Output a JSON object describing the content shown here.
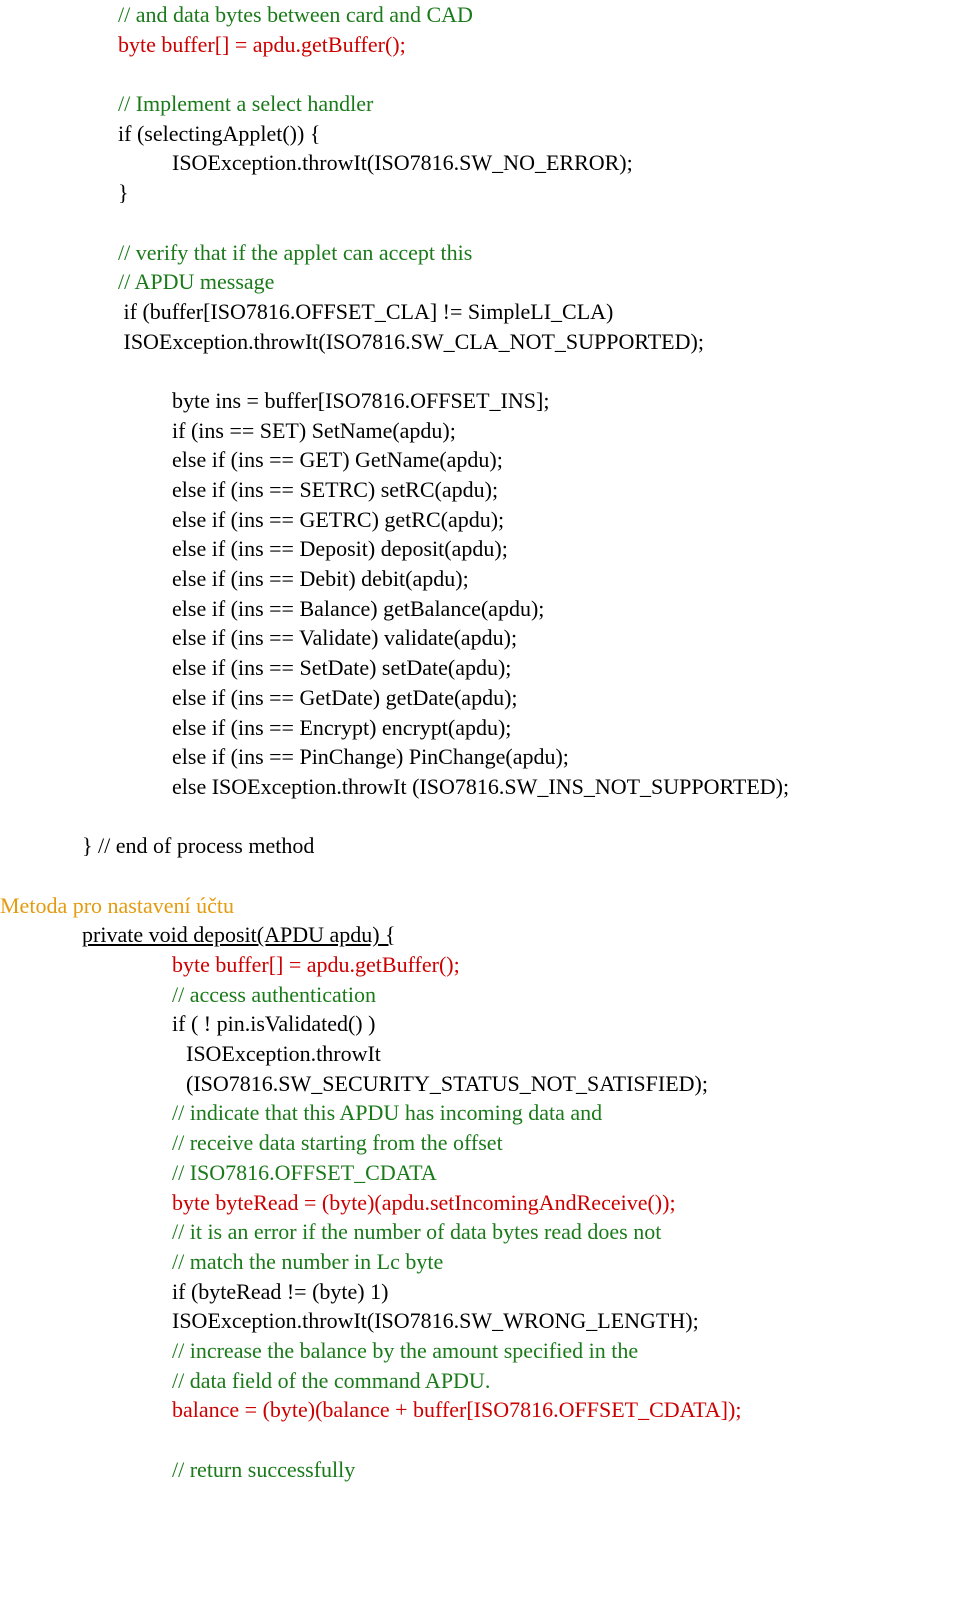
{
  "lines": [
    {
      "indent": "ind1",
      "spans": [
        {
          "cls": "c-green",
          "text": "// and data bytes between card and CAD"
        }
      ]
    },
    {
      "indent": "ind1",
      "spans": [
        {
          "cls": "c-red",
          "text": "byte buffer[] = apdu.getBuffer();"
        }
      ]
    },
    {
      "indent": "ind1",
      "spans": [
        {
          "cls": "c-black",
          "text": " "
        }
      ]
    },
    {
      "indent": "ind1",
      "spans": [
        {
          "cls": "c-green",
          "text": "// Implement a select handler"
        }
      ]
    },
    {
      "indent": "ind1",
      "spans": [
        {
          "cls": "c-black",
          "text": "if (selectingApplet()) {"
        }
      ]
    },
    {
      "indent": "ind2",
      "spans": [
        {
          "cls": "c-black",
          "text": "ISOException.throwIt(ISO7816.SW_NO_ERROR);"
        }
      ]
    },
    {
      "indent": "ind1",
      "spans": [
        {
          "cls": "c-black",
          "text": "}"
        }
      ]
    },
    {
      "indent": "ind1",
      "spans": [
        {
          "cls": "c-black",
          "text": " "
        }
      ]
    },
    {
      "indent": "ind1",
      "spans": [
        {
          "cls": "c-green",
          "text": "// verify that if the applet can accept this"
        }
      ]
    },
    {
      "indent": "ind1",
      "spans": [
        {
          "cls": "c-green",
          "text": "// APDU message"
        }
      ]
    },
    {
      "indent": "ind1",
      "spans": [
        {
          "cls": "c-black",
          "text": " if (buffer[ISO7816.OFFSET_CLA] != SimpleLI_CLA)"
        }
      ]
    },
    {
      "indent": "ind1",
      "spans": [
        {
          "cls": "c-black",
          "text": " ISOException.throwIt(ISO7816.SW_CLA_NOT_SUPPORTED);"
        }
      ]
    },
    {
      "indent": "ind1",
      "spans": [
        {
          "cls": "c-black",
          "text": " "
        }
      ]
    },
    {
      "indent": "ind2",
      "spans": [
        {
          "cls": "c-black",
          "text": "byte ins = buffer[ISO7816.OFFSET_INS];"
        }
      ]
    },
    {
      "indent": "ind2",
      "spans": [
        {
          "cls": "c-black",
          "text": "if (ins == SET) SetName(apdu);"
        }
      ]
    },
    {
      "indent": "ind2",
      "spans": [
        {
          "cls": "c-black",
          "text": "else if (ins == GET) GetName(apdu);"
        }
      ]
    },
    {
      "indent": "ind2",
      "spans": [
        {
          "cls": "c-black",
          "text": "else if (ins == SETRC) setRC(apdu);"
        }
      ]
    },
    {
      "indent": "ind2",
      "spans": [
        {
          "cls": "c-black",
          "text": "else if (ins == GETRC) getRC(apdu);"
        }
      ]
    },
    {
      "indent": "ind2",
      "spans": [
        {
          "cls": "c-black",
          "text": "else if (ins == Deposit) deposit(apdu);"
        }
      ]
    },
    {
      "indent": "ind2",
      "spans": [
        {
          "cls": "c-black",
          "text": "else if (ins == Debit) debit(apdu);"
        }
      ]
    },
    {
      "indent": "ind2",
      "spans": [
        {
          "cls": "c-black",
          "text": "else if (ins == Balance) getBalance(apdu);"
        }
      ]
    },
    {
      "indent": "ind2",
      "spans": [
        {
          "cls": "c-black",
          "text": "else if (ins == Validate) validate(apdu);"
        }
      ]
    },
    {
      "indent": "ind2",
      "spans": [
        {
          "cls": "c-black",
          "text": "else if (ins == SetDate) setDate(apdu);"
        }
      ]
    },
    {
      "indent": "ind2",
      "spans": [
        {
          "cls": "c-black",
          "text": "else if (ins == GetDate) getDate(apdu);"
        }
      ]
    },
    {
      "indent": "ind2",
      "spans": [
        {
          "cls": "c-black",
          "text": "else if (ins == Encrypt) encrypt(apdu);"
        }
      ]
    },
    {
      "indent": "ind2",
      "spans": [
        {
          "cls": "c-black",
          "text": "else if (ins == PinChange) PinChange(apdu);"
        }
      ]
    },
    {
      "indent": "ind2",
      "spans": [
        {
          "cls": "c-black",
          "text": "else ISOException.throwIt (ISO7816.SW_INS_NOT_SUPPORTED);"
        }
      ]
    },
    {
      "indent": "ind1",
      "spans": [
        {
          "cls": "c-black",
          "text": " "
        }
      ]
    },
    {
      "indent": "ind05",
      "spans": [
        {
          "cls": "c-black",
          "text": "} // end of process method"
        }
      ]
    },
    {
      "indent": "ind0",
      "spans": [
        {
          "cls": "c-black",
          "text": " "
        }
      ]
    },
    {
      "indent": "ind0",
      "spans": [
        {
          "cls": "c-orange",
          "text": "Metoda pro nastavení účtu"
        }
      ]
    },
    {
      "indent": "ind05",
      "spans": [
        {
          "cls": "c-black u",
          "text": "private void deposit(APDU apdu) {"
        }
      ]
    },
    {
      "indent": "ind2",
      "spans": [
        {
          "cls": "c-red",
          "text": "byte buffer[] = apdu.getBuffer();"
        }
      ]
    },
    {
      "indent": "ind2",
      "spans": [
        {
          "cls": "c-green",
          "text": "// access authentication"
        }
      ]
    },
    {
      "indent": "ind2",
      "spans": [
        {
          "cls": "c-black",
          "text": "if ( ! pin.isValidated() )"
        }
      ]
    },
    {
      "indent": "ind3",
      "spans": [
        {
          "cls": "c-black",
          "text": "ISOException.throwIt"
        }
      ]
    },
    {
      "indent": "ind3",
      "spans": [
        {
          "cls": "c-black",
          "text": "(ISO7816.SW_SECURITY_STATUS_NOT_SATISFIED);"
        }
      ]
    },
    {
      "indent": "ind2",
      "spans": [
        {
          "cls": "c-green",
          "text": "// indicate that this APDU has incoming data and"
        }
      ]
    },
    {
      "indent": "ind2",
      "spans": [
        {
          "cls": "c-green",
          "text": "// receive data starting from the offset"
        }
      ]
    },
    {
      "indent": "ind2",
      "spans": [
        {
          "cls": "c-green",
          "text": "// ISO7816.OFFSET_CDATA"
        }
      ]
    },
    {
      "indent": "ind2",
      "spans": [
        {
          "cls": "c-red",
          "text": "byte byteRead = (byte)(apdu.setIncomingAndReceive());"
        }
      ]
    },
    {
      "indent": "ind2",
      "spans": [
        {
          "cls": "c-green",
          "text": "// it is an error if the number of data bytes read does not"
        }
      ]
    },
    {
      "indent": "ind2",
      "spans": [
        {
          "cls": "c-green",
          "text": "// match the number in Lc byte"
        }
      ]
    },
    {
      "indent": "ind2",
      "spans": [
        {
          "cls": "c-black",
          "text": "if (byteRead != (byte) 1)"
        }
      ]
    },
    {
      "indent": "ind2",
      "spans": [
        {
          "cls": "c-black",
          "text": "ISOException.throwIt(ISO7816.SW_WRONG_LENGTH);"
        }
      ]
    },
    {
      "indent": "ind2",
      "spans": [
        {
          "cls": "c-green",
          "text": "// increase the balance by the amount specified in the"
        }
      ]
    },
    {
      "indent": "ind2",
      "spans": [
        {
          "cls": "c-green",
          "text": "// data field of the command APDU."
        }
      ]
    },
    {
      "indent": "ind2",
      "spans": [
        {
          "cls": "c-red",
          "text": "balance = (byte)(balance + buffer[ISO7816.OFFSET_CDATA]);"
        }
      ]
    },
    {
      "indent": "ind2",
      "spans": [
        {
          "cls": "c-black",
          "text": " "
        }
      ]
    },
    {
      "indent": "ind2",
      "spans": [
        {
          "cls": "c-green",
          "text": "// return successfully"
        }
      ]
    }
  ]
}
